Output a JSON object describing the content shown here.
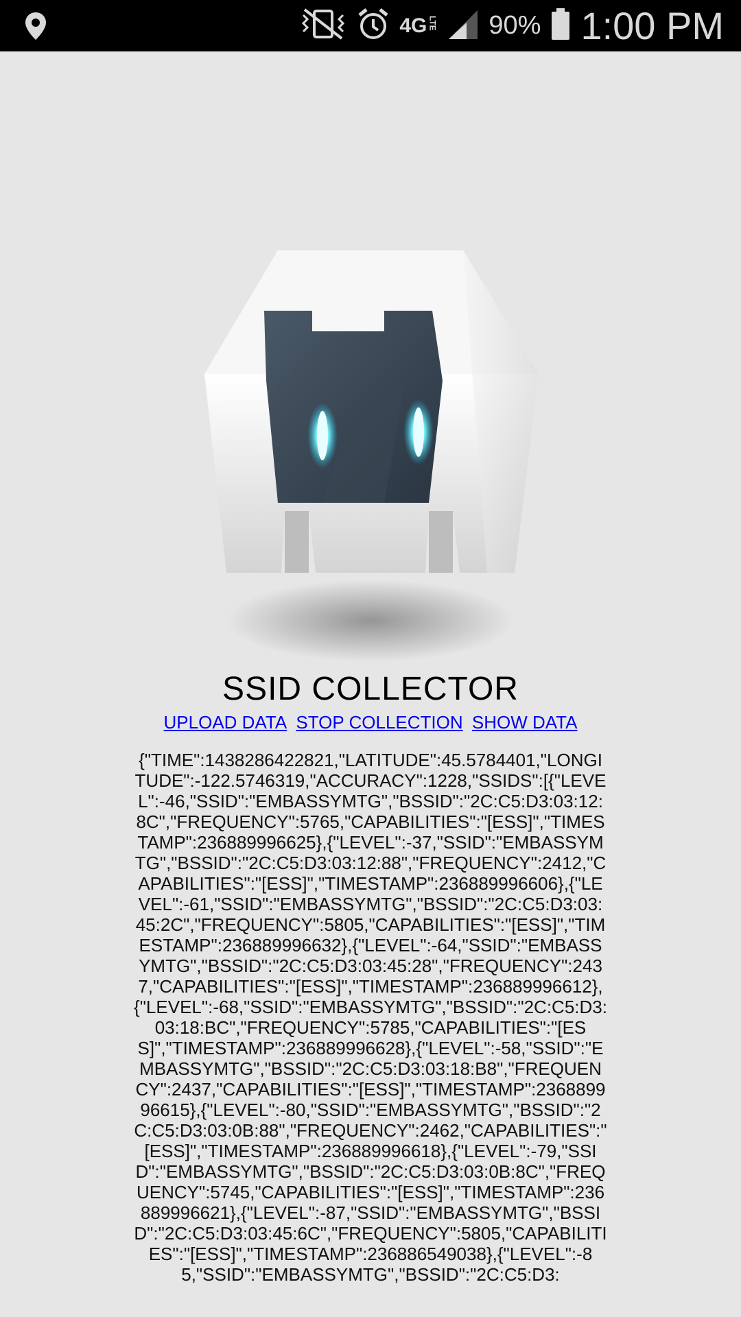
{
  "status_bar": {
    "network_label": "4G",
    "network_sub": "LTE",
    "battery_percent": "90%",
    "time": "1:00 PM"
  },
  "app": {
    "title": "SSID COLLECTOR",
    "links": {
      "upload": "UPLOAD DATA",
      "stop": "STOP COLLECTION",
      "show": "SHOW DATA"
    },
    "json_text": "{\"TIME\":1438286422821,\"LATITUDE\":45.5784401,\"LONGITUDE\":-122.5746319,\"ACCURACY\":1228,\"SSIDS\":[{\"LEVEL\":-46,\"SSID\":\"EMBASSYMTG\",\"BSSID\":\"2C:C5:D3:03:12:8C\",\"FREQUENCY\":5765,\"CAPABILITIES\":\"[ESS]\",\"TIMESTAMP\":236889996625},{\"LEVEL\":-37,\"SSID\":\"EMBASSYMTG\",\"BSSID\":\"2C:C5:D3:03:12:88\",\"FREQUENCY\":2412,\"CAPABILITIES\":\"[ESS]\",\"TIMESTAMP\":236889996606},{\"LEVEL\":-61,\"SSID\":\"EMBASSYMTG\",\"BSSID\":\"2C:C5:D3:03:45:2C\",\"FREQUENCY\":5805,\"CAPABILITIES\":\"[ESS]\",\"TIMESTAMP\":236889996632},{\"LEVEL\":-64,\"SSID\":\"EMBASSYMTG\",\"BSSID\":\"2C:C5:D3:03:45:28\",\"FREQUENCY\":2437,\"CAPABILITIES\":\"[ESS]\",\"TIMESTAMP\":236889996612},{\"LEVEL\":-68,\"SSID\":\"EMBASSYMTG\",\"BSSID\":\"2C:C5:D3:03:18:BC\",\"FREQUENCY\":5785,\"CAPABILITIES\":\"[ESS]\",\"TIMESTAMP\":236889996628},{\"LEVEL\":-58,\"SSID\":\"EMBASSYMTG\",\"BSSID\":\"2C:C5:D3:03:18:B8\",\"FREQUENCY\":2437,\"CAPABILITIES\":\"[ESS]\",\"TIMESTAMP\":236889996615},{\"LEVEL\":-80,\"SSID\":\"EMBASSYMTG\",\"BSSID\":\"2C:C5:D3:03:0B:88\",\"FREQUENCY\":2462,\"CAPABILITIES\":\"[ESS]\",\"TIMESTAMP\":236889996618},{\"LEVEL\":-79,\"SSID\":\"EMBASSYMTG\",\"BSSID\":\"2C:C5:D3:03:0B:8C\",\"FREQUENCY\":5745,\"CAPABILITIES\":\"[ESS]\",\"TIMESTAMP\":236889996621},{\"LEVEL\":-87,\"SSID\":\"EMBASSYMTG\",\"BSSID\":\"2C:C5:D3:03:45:6C\",\"FREQUENCY\":5805,\"CAPABILITIES\":\"[ESS]\",\"TIMESTAMP\":236886549038},{\"LEVEL\":-85,\"SSID\":\"EMBASSYMTG\",\"BSSID\":\"2C:C5:D3:"
  },
  "icons": {
    "location": "location-pin-icon",
    "vibrate": "vibrate-mute-icon",
    "alarm": "alarm-clock-icon",
    "network": "network-4g-lte-icon",
    "signal": "signal-strength-icon",
    "battery": "battery-icon",
    "logo": "cordova-robot-logo"
  }
}
